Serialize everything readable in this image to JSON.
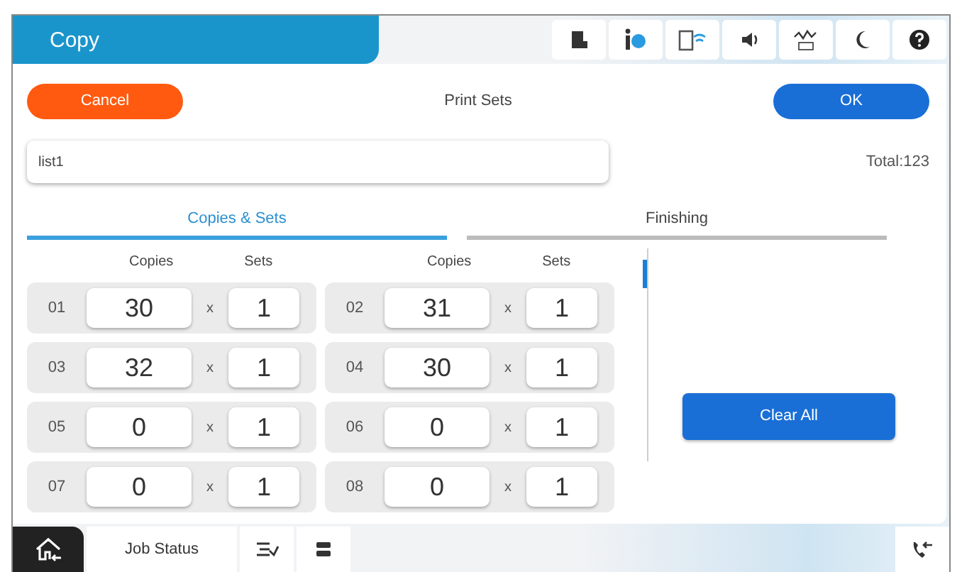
{
  "header": {
    "title": "Copy"
  },
  "toolbar": {
    "cancel": "Cancel",
    "title": "Print Sets",
    "ok": "OK"
  },
  "name_field": {
    "value": "list1"
  },
  "total": "Total:123",
  "tabs": [
    {
      "label": "Copies & Sets",
      "selected": true
    },
    {
      "label": "Finishing",
      "selected": false
    }
  ],
  "column_headers": [
    "Copies",
    "Sets",
    "Copies",
    "Sets"
  ],
  "entries": [
    {
      "number": "01",
      "copies": "30",
      "times": "x",
      "sets": "1"
    },
    {
      "number": "02",
      "copies": "31",
      "times": "x",
      "sets": "1"
    },
    {
      "number": "03",
      "copies": "32",
      "times": "x",
      "sets": "1"
    },
    {
      "number": "04",
      "copies": "30",
      "times": "x",
      "sets": "1"
    },
    {
      "number": "05",
      "copies": "0",
      "times": "x",
      "sets": "1"
    },
    {
      "number": "06",
      "copies": "0",
      "times": "x",
      "sets": "1"
    },
    {
      "number": "07",
      "copies": "0",
      "times": "x",
      "sets": "1"
    },
    {
      "number": "08",
      "copies": "0",
      "times": "x",
      "sets": "1"
    }
  ],
  "clear_button": "Clear All",
  "bottom_bar": {
    "job_status": "Job Status"
  }
}
